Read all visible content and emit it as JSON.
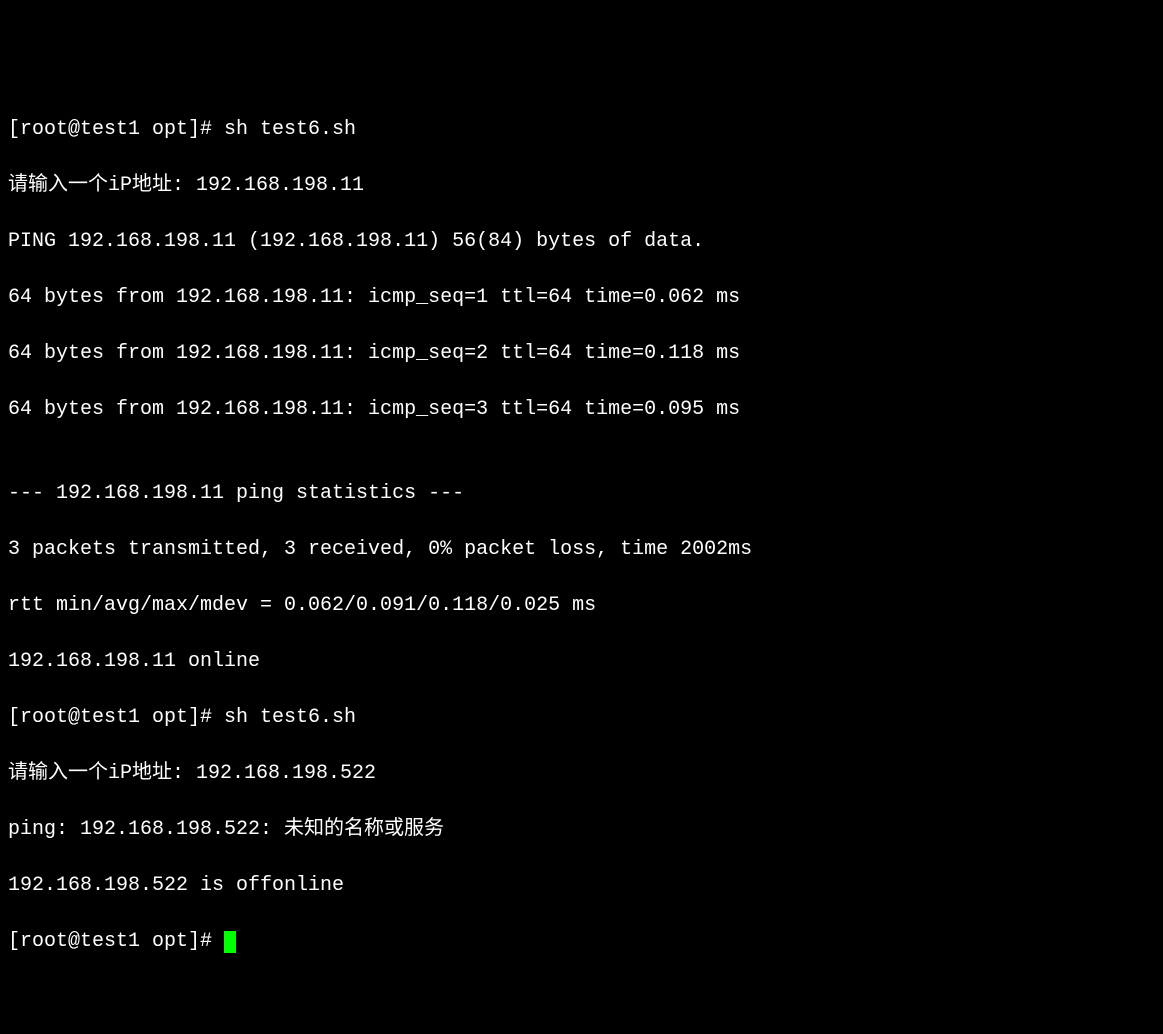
{
  "lines": {
    "l1": "[root@test1 opt]# sh test6.sh",
    "l2": "请输入一个iP地址: 192.168.198.11",
    "l3": "PING 192.168.198.11 (192.168.198.11) 56(84) bytes of data.",
    "l4": "64 bytes from 192.168.198.11: icmp_seq=1 ttl=64 time=0.062 ms",
    "l5": "64 bytes from 192.168.198.11: icmp_seq=2 ttl=64 time=0.118 ms",
    "l6": "64 bytes from 192.168.198.11: icmp_seq=3 ttl=64 time=0.095 ms",
    "l7": "",
    "l8": "--- 192.168.198.11 ping statistics ---",
    "l9": "3 packets transmitted, 3 received, 0% packet loss, time 2002ms",
    "l10": "rtt min/avg/max/mdev = 0.062/0.091/0.118/0.025 ms",
    "l11": "192.168.198.11 online",
    "l12": "[root@test1 opt]# sh test6.sh",
    "l13": "请输入一个iP地址: 192.168.198.522",
    "l14": "ping: 192.168.198.522: 未知的名称或服务",
    "l15": "192.168.198.522 is offonline",
    "l16": "[root@test1 opt]# "
  }
}
